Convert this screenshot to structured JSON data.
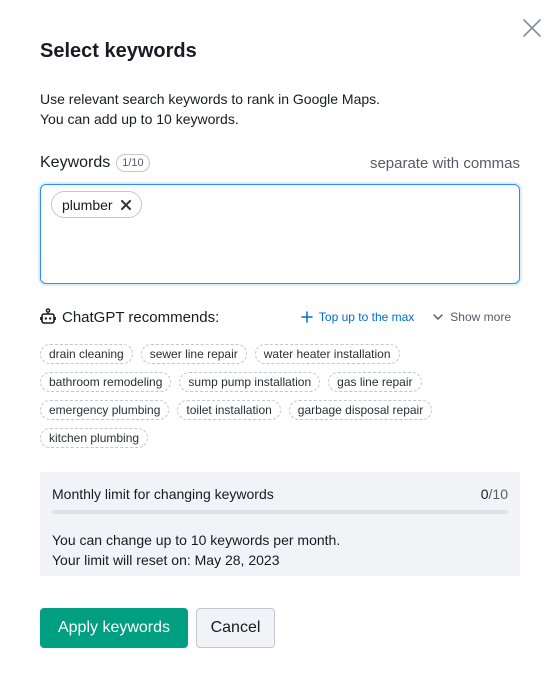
{
  "dialog": {
    "title": "Select keywords",
    "description_line1": "Use relevant search keywords to rank in Google Maps.",
    "description_line2": "You can add up to 10 keywords."
  },
  "keywords": {
    "label": "Keywords",
    "count": "1/10",
    "hint": "separate with commas",
    "chips": [
      "plumber"
    ]
  },
  "recommendations": {
    "title": "ChatGPT recommends:",
    "top_up_label": "Top up to the max",
    "show_more_label": "Show more",
    "items": [
      "drain cleaning",
      "sewer line repair",
      "water heater installation",
      "bathroom remodeling",
      "sump pump installation",
      "gas line repair",
      "emergency plumbing",
      "toilet installation",
      "garbage disposal repair",
      "kitchen plumbing"
    ]
  },
  "limit": {
    "title": "Monthly limit for changing keywords",
    "used": "0",
    "max": "/10",
    "progress_fraction": 0,
    "line1": "You can change up to 10 keywords per month.",
    "line2": "Your limit will reset on: May 28, 2023"
  },
  "actions": {
    "apply_label": "Apply keywords",
    "cancel_label": "Cancel"
  },
  "colors": {
    "accent": "#009f81",
    "link": "#006dca",
    "focus": "#2b8eff"
  }
}
